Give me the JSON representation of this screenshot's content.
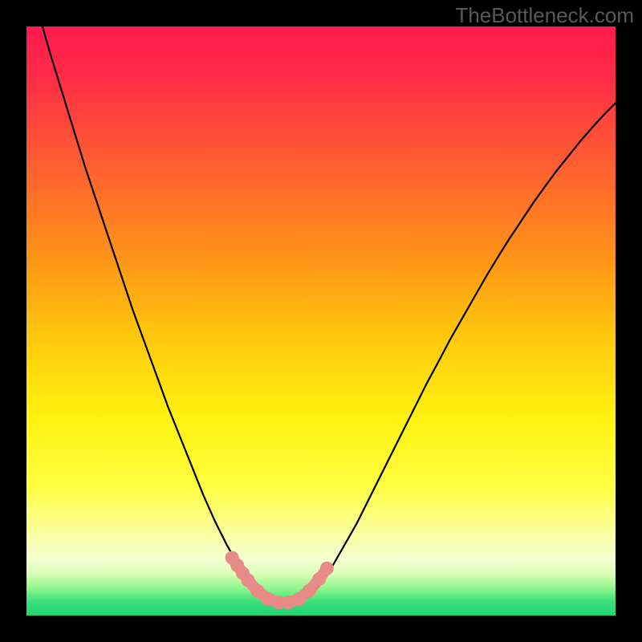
{
  "watermark": "TheBottleneck.com",
  "colors": {
    "frame": "#000000",
    "gradient_stops": [
      {
        "offset": 0.0,
        "color": "#ff1a4d"
      },
      {
        "offset": 0.08,
        "color": "#ff2b47"
      },
      {
        "offset": 0.22,
        "color": "#ff5a33"
      },
      {
        "offset": 0.38,
        "color": "#ff8f1a"
      },
      {
        "offset": 0.52,
        "color": "#ffc60d"
      },
      {
        "offset": 0.66,
        "color": "#fff110"
      },
      {
        "offset": 0.78,
        "color": "#ffff40"
      },
      {
        "offset": 0.86,
        "color": "#faffa0"
      },
      {
        "offset": 0.905,
        "color": "#f4ffd2"
      },
      {
        "offset": 0.93,
        "color": "#d8ffb4"
      },
      {
        "offset": 0.955,
        "color": "#8cf58c"
      },
      {
        "offset": 0.975,
        "color": "#3fe07a"
      },
      {
        "offset": 1.0,
        "color": "#1dd66f"
      }
    ],
    "curve": "#000000",
    "marker_fill": "#e88a86",
    "marker_stroke": "#d86c68"
  },
  "chart_data": {
    "type": "line",
    "title": "",
    "xlabel": "",
    "ylabel": "",
    "xlim": [
      0,
      1
    ],
    "ylim": [
      0,
      1
    ],
    "x": [
      0.0,
      0.02,
      0.04,
      0.06,
      0.08,
      0.1,
      0.12,
      0.14,
      0.16,
      0.18,
      0.2,
      0.22,
      0.24,
      0.26,
      0.28,
      0.3,
      0.32,
      0.34,
      0.36,
      0.38,
      0.4,
      0.42,
      0.44,
      0.46,
      0.48,
      0.5,
      0.52,
      0.54,
      0.56,
      0.58,
      0.6,
      0.62,
      0.64,
      0.66,
      0.68,
      0.7,
      0.72,
      0.74,
      0.76,
      0.78,
      0.8,
      0.82,
      0.84,
      0.86,
      0.88,
      0.9,
      0.92,
      0.94,
      0.96,
      0.98,
      1.0
    ],
    "y": [
      1.09,
      1.025,
      0.955,
      0.89,
      0.825,
      0.76,
      0.7,
      0.64,
      0.58,
      0.52,
      0.465,
      0.41,
      0.355,
      0.305,
      0.255,
      0.205,
      0.16,
      0.12,
      0.085,
      0.055,
      0.032,
      0.023,
      0.021,
      0.023,
      0.032,
      0.055,
      0.085,
      0.12,
      0.155,
      0.195,
      0.235,
      0.275,
      0.315,
      0.355,
      0.395,
      0.432,
      0.47,
      0.505,
      0.54,
      0.575,
      0.608,
      0.64,
      0.67,
      0.7,
      0.728,
      0.755,
      0.78,
      0.805,
      0.828,
      0.85,
      0.87
    ],
    "markers": {
      "x": [
        0.349,
        0.358,
        0.367,
        0.376,
        0.392,
        0.41,
        0.428,
        0.445,
        0.463,
        0.48,
        0.497,
        0.51
      ],
      "y": [
        0.098,
        0.085,
        0.072,
        0.06,
        0.042,
        0.028,
        0.022,
        0.022,
        0.028,
        0.042,
        0.062,
        0.08
      ]
    }
  }
}
